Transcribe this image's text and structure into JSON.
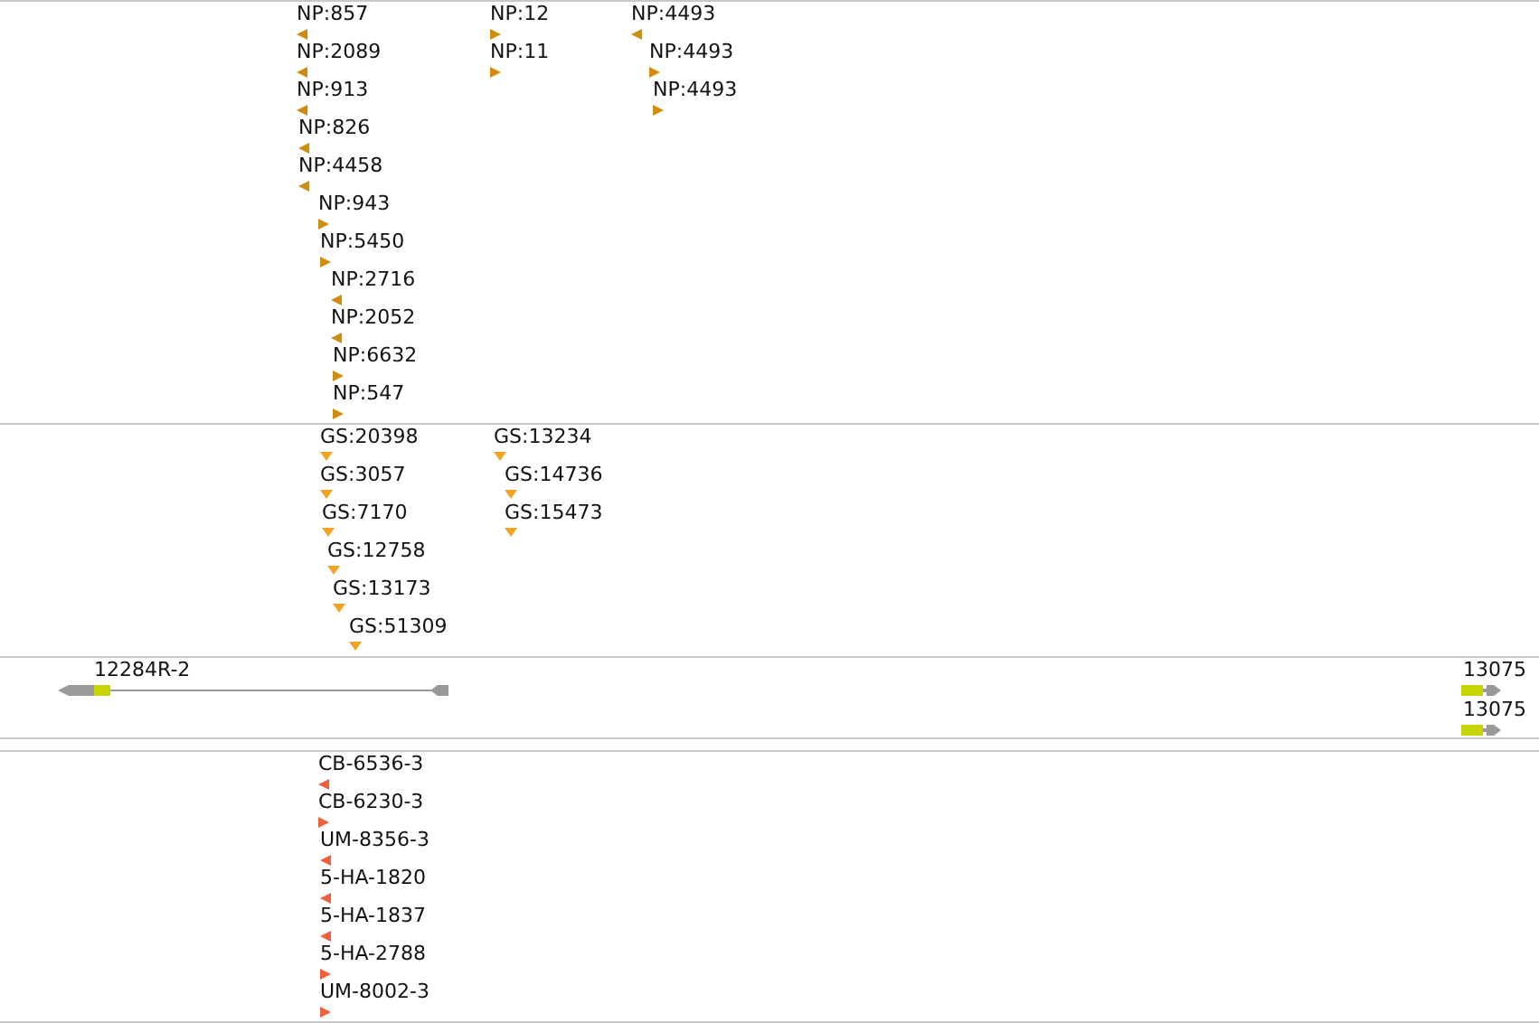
{
  "tracks": [
    {
      "kind": "markers",
      "color": "#d08c0c",
      "features": [
        {
          "label": "NP:857",
          "kind": "left"
        },
        {
          "label": "NP:2089",
          "kind": "left"
        },
        {
          "label": "NP:913",
          "kind": "left"
        },
        {
          "label": "NP:826",
          "kind": "left"
        },
        {
          "label": "NP:4458",
          "kind": "left"
        },
        {
          "label": "NP:943",
          "kind": "right"
        },
        {
          "label": "NP:5450",
          "kind": "right"
        },
        {
          "label": "NP:2716",
          "kind": "left"
        },
        {
          "label": "NP:2052",
          "kind": "left"
        },
        {
          "label": "NP:6632",
          "kind": "right"
        },
        {
          "label": "NP:547",
          "kind": "right"
        },
        {
          "label": "NP:12",
          "kind": "right"
        },
        {
          "label": "NP:11",
          "kind": "right"
        },
        {
          "label": "NP:4493",
          "kind": "left"
        },
        {
          "label": "NP:4493",
          "kind": "right"
        },
        {
          "label": "NP:4493",
          "kind": "right"
        }
      ]
    },
    {
      "kind": "markers",
      "color": "#f0a422",
      "features": [
        {
          "label": "GS:20398",
          "kind": "down"
        },
        {
          "label": "GS:3057",
          "kind": "down"
        },
        {
          "label": "GS:7170",
          "kind": "down"
        },
        {
          "label": "GS:12758",
          "kind": "down"
        },
        {
          "label": "GS:13173",
          "kind": "down"
        },
        {
          "label": "GS:51309",
          "kind": "down"
        },
        {
          "label": "GS:13234",
          "kind": "down"
        },
        {
          "label": "GS:14736",
          "kind": "down"
        },
        {
          "label": "GS:15473",
          "kind": "down"
        }
      ]
    },
    {
      "kind": "genes",
      "color": "#c8d400",
      "features": [
        {
          "label": "12284R-2",
          "kind": "left"
        },
        {
          "label": "13075",
          "kind": "right"
        },
        {
          "label": "13075",
          "kind": "right"
        }
      ]
    },
    {
      "kind": "markers",
      "color": "#f0603c",
      "features": [
        {
          "label": "CB-6536-3",
          "kind": "left"
        },
        {
          "label": "CB-6230-3",
          "kind": "right"
        },
        {
          "label": "UM-8356-3",
          "kind": "left"
        },
        {
          "label": "5-HA-1820",
          "kind": "left"
        },
        {
          "label": "5-HA-1837",
          "kind": "left"
        },
        {
          "label": "5-HA-2788",
          "kind": "right"
        },
        {
          "label": "UM-8002-3",
          "kind": "right"
        }
      ]
    }
  ]
}
